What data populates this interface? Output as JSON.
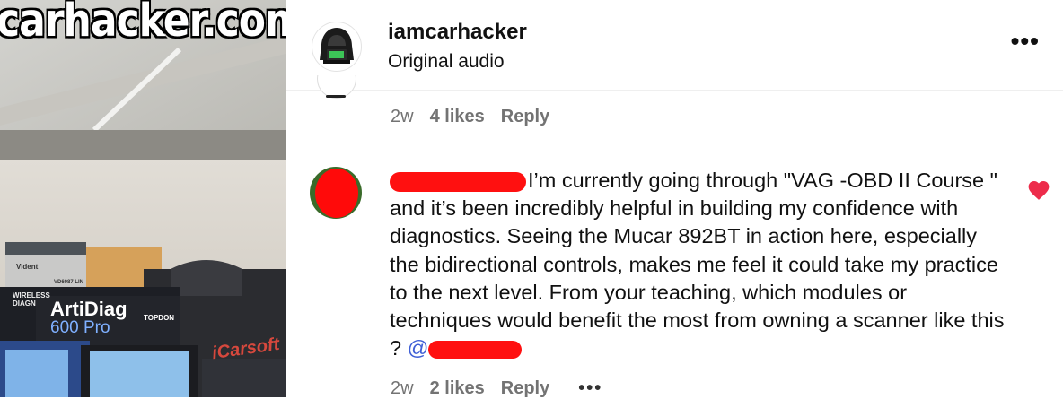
{
  "video": {
    "watermark": "icarhacker.com",
    "box_brand": "ArtiDiag",
    "box_model": "600 Pro",
    "box_maker": "TOPDON",
    "box_side": "WIRELESS DIAGN",
    "tablet_brand": "iCarsoft",
    "box2_brand": "Vident",
    "box2_label": "VD6087 LIN"
  },
  "header": {
    "username": "iamcarhacker",
    "subtitle": "Original audio",
    "more_label": "•••"
  },
  "prev_comment": {
    "time": "2w",
    "likes": "4 likes",
    "reply": "Reply"
  },
  "comment": {
    "text": "I’m currently going through \"VAG -OBD II Course \" and it’s been incredibly helpful in building my confidence with diagnostics. Seeing the Mucar 892BT in action here, especially the bidirectional controls, makes me feel it could take my practice to the next level. From your teaching, which modules or techniques would benefit the most from owning a scanner like this ?",
    "mention_prefix": "@",
    "time": "2w",
    "likes": "2 likes",
    "reply": "Reply",
    "more": "•••"
  },
  "colors": {
    "like_heart": "#ed2c4b",
    "mention": "#3f5fd6",
    "redaction": "#ff1010",
    "watermark_green": "#2fd33b"
  }
}
